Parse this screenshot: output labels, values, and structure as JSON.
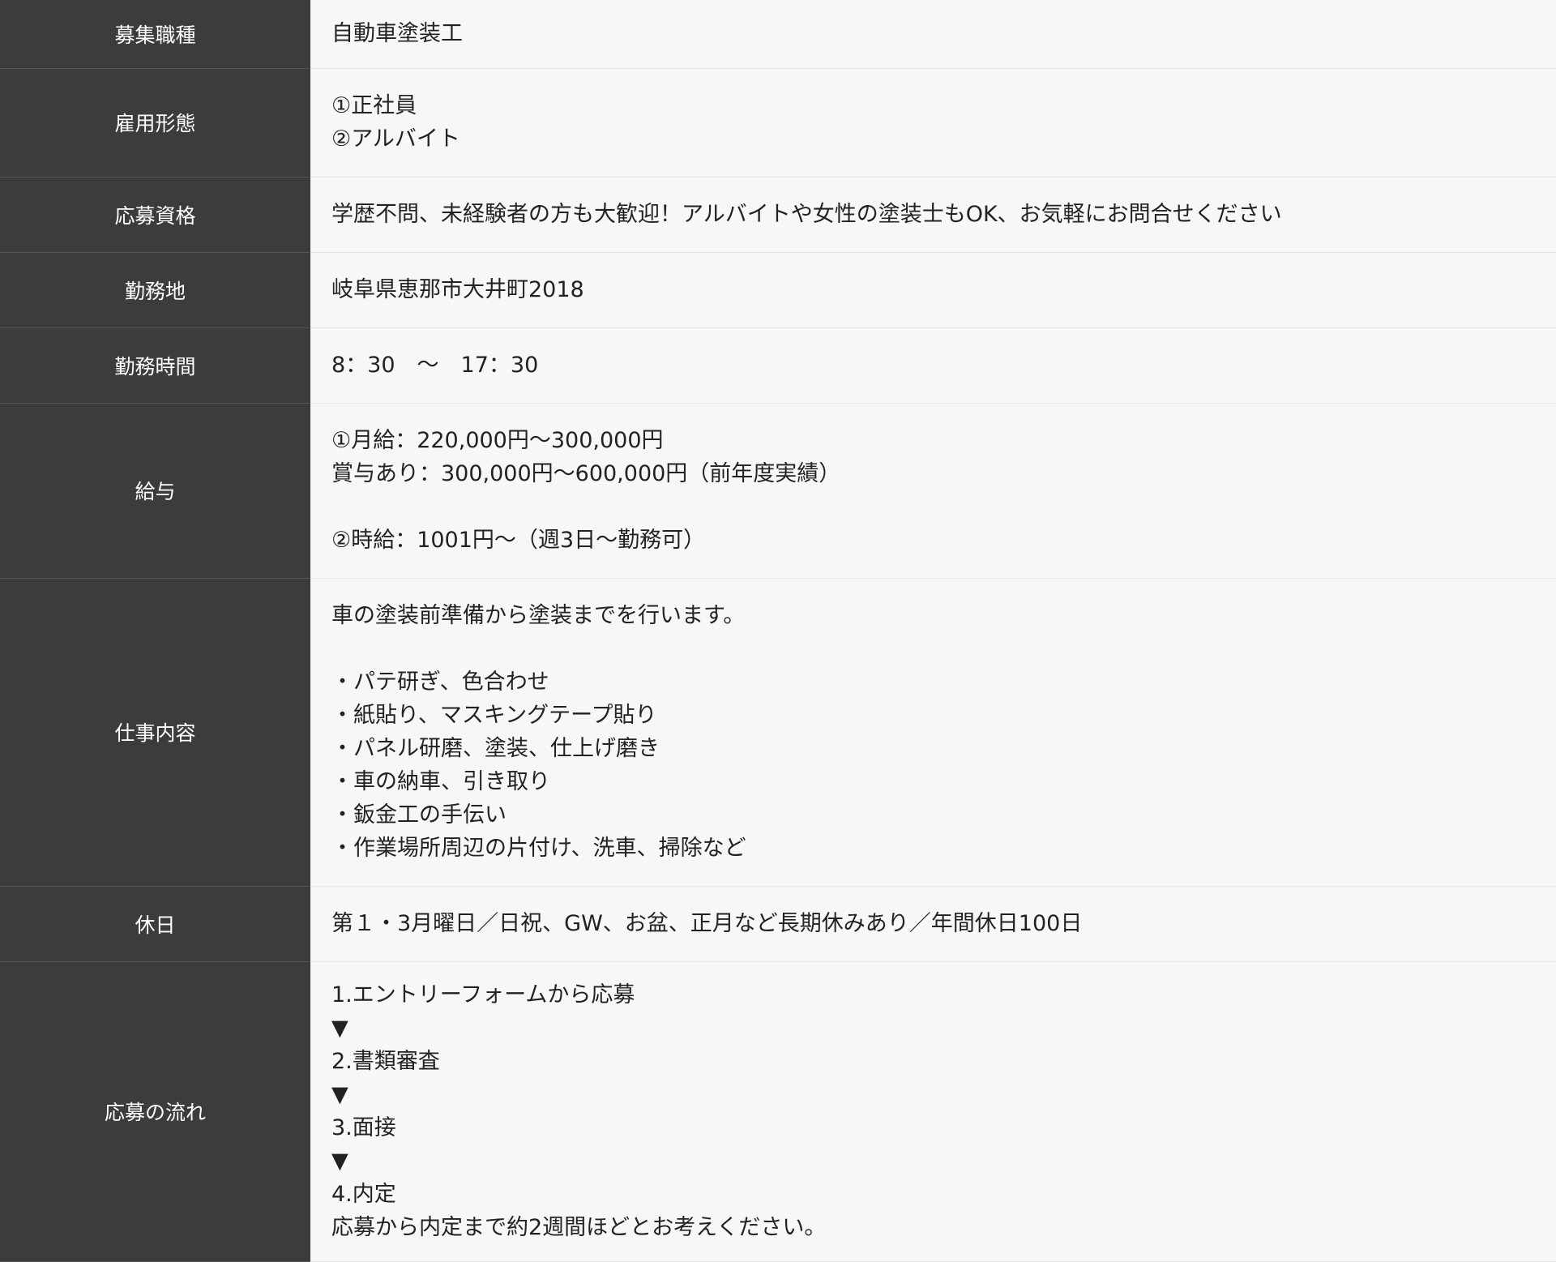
{
  "rows": [
    {
      "label": "募集職種",
      "lines": [
        "自動車塗装工"
      ]
    },
    {
      "label": "雇用形態",
      "lines": [
        "①正社員",
        "②アルバイト"
      ]
    },
    {
      "label": "応募資格",
      "lines": [
        "学歴不問、未経験者の方も大歓迎！アルバイトや女性の塗装士もOK、お気軽にお問合せください"
      ]
    },
    {
      "label": "勤務地",
      "lines": [
        "岐阜県恵那市大井町2018"
      ]
    },
    {
      "label": "勤務時間",
      "lines": [
        "8：30　～　17：30"
      ]
    },
    {
      "label": "給与",
      "lines": [
        "①月給：220,000円～300,000円",
        "賞与あり：300,000円～600,000円（前年度実績）",
        "",
        "②時給：1001円～（週3日～勤務可）"
      ]
    },
    {
      "label": "仕事内容",
      "lines": [
        "車の塗装前準備から塗装までを行います。",
        "",
        "・パテ研ぎ、色合わせ",
        "・紙貼り、マスキングテープ貼り",
        "・パネル研磨、塗装、仕上げ磨き",
        "・車の納車、引き取り",
        "・鈑金工の手伝い",
        "・作業場所周辺の片付け、洗車、掃除など"
      ]
    },
    {
      "label": "休日",
      "lines": [
        "第１・3月曜日／日祝、GW、お盆、正月など長期休みあり／年間休日100日"
      ]
    },
    {
      "label": "応募の流れ",
      "lines": [
        "1.エントリーフォームから応募",
        "▼",
        "2.書類審査",
        "▼",
        "3.面接",
        "▼",
        "4.内定",
        "応募から内定まで約2週間ほどとお考えください。"
      ]
    }
  ],
  "colors": {
    "header_bg": "#3c3c3c",
    "header_text": "#ffffff",
    "cell_bg": "#f7f7f7",
    "cell_text": "#222222"
  }
}
